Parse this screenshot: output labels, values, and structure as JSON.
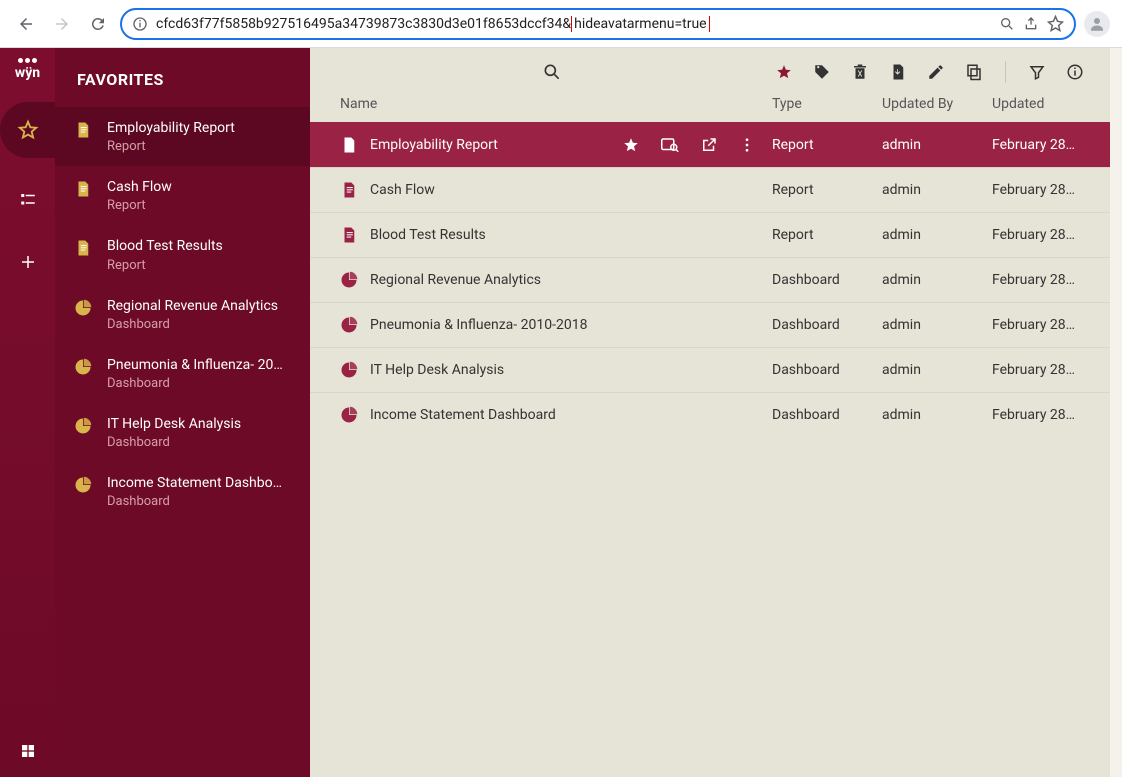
{
  "browser": {
    "url_main": "cfcd63f77f5858b927516495a34739873c3830d3e01f8653dccf34&",
    "url_highlight": "hideavatarmenu=true"
  },
  "sidebar": {
    "header": "FAVORITES",
    "items": [
      {
        "title": "Employability Report",
        "type": "Report",
        "icon": "doc",
        "selected": true
      },
      {
        "title": "Cash Flow",
        "type": "Report",
        "icon": "doc",
        "selected": false
      },
      {
        "title": "Blood Test Results",
        "type": "Report",
        "icon": "doc",
        "selected": false
      },
      {
        "title": "Regional Revenue Analytics",
        "type": "Dashboard",
        "icon": "pie",
        "selected": false
      },
      {
        "title": "Pneumonia & Influenza- 20…",
        "type": "Dashboard",
        "icon": "pie",
        "selected": false
      },
      {
        "title": "IT Help Desk Analysis",
        "type": "Dashboard",
        "icon": "pie",
        "selected": false
      },
      {
        "title": "Income Statement Dashbo…",
        "type": "Dashboard",
        "icon": "pie",
        "selected": false
      }
    ]
  },
  "list": {
    "columns": {
      "name": "Name",
      "type": "Type",
      "updatedBy": "Updated By",
      "updated": "Updated"
    },
    "rows": [
      {
        "name": "Employability Report",
        "type": "Report",
        "updatedBy": "admin",
        "updated": "February 28…",
        "icon": "doc",
        "selected": true
      },
      {
        "name": "Cash Flow",
        "type": "Report",
        "updatedBy": "admin",
        "updated": "February 28…",
        "icon": "doc",
        "selected": false
      },
      {
        "name": "Blood Test Results",
        "type": "Report",
        "updatedBy": "admin",
        "updated": "February 28…",
        "icon": "doc",
        "selected": false
      },
      {
        "name": "Regional Revenue Analytics",
        "type": "Dashboard",
        "updatedBy": "admin",
        "updated": "February 28…",
        "icon": "pie",
        "selected": false
      },
      {
        "name": "Pneumonia & Influenza- 2010-2018",
        "type": "Dashboard",
        "updatedBy": "admin",
        "updated": "February 28…",
        "icon": "pie",
        "selected": false
      },
      {
        "name": "IT Help Desk Analysis",
        "type": "Dashboard",
        "updatedBy": "admin",
        "updated": "February 28…",
        "icon": "pie",
        "selected": false
      },
      {
        "name": "Income Statement Dashboard",
        "type": "Dashboard",
        "updatedBy": "admin",
        "updated": "February 28…",
        "icon": "pie",
        "selected": false
      }
    ]
  }
}
